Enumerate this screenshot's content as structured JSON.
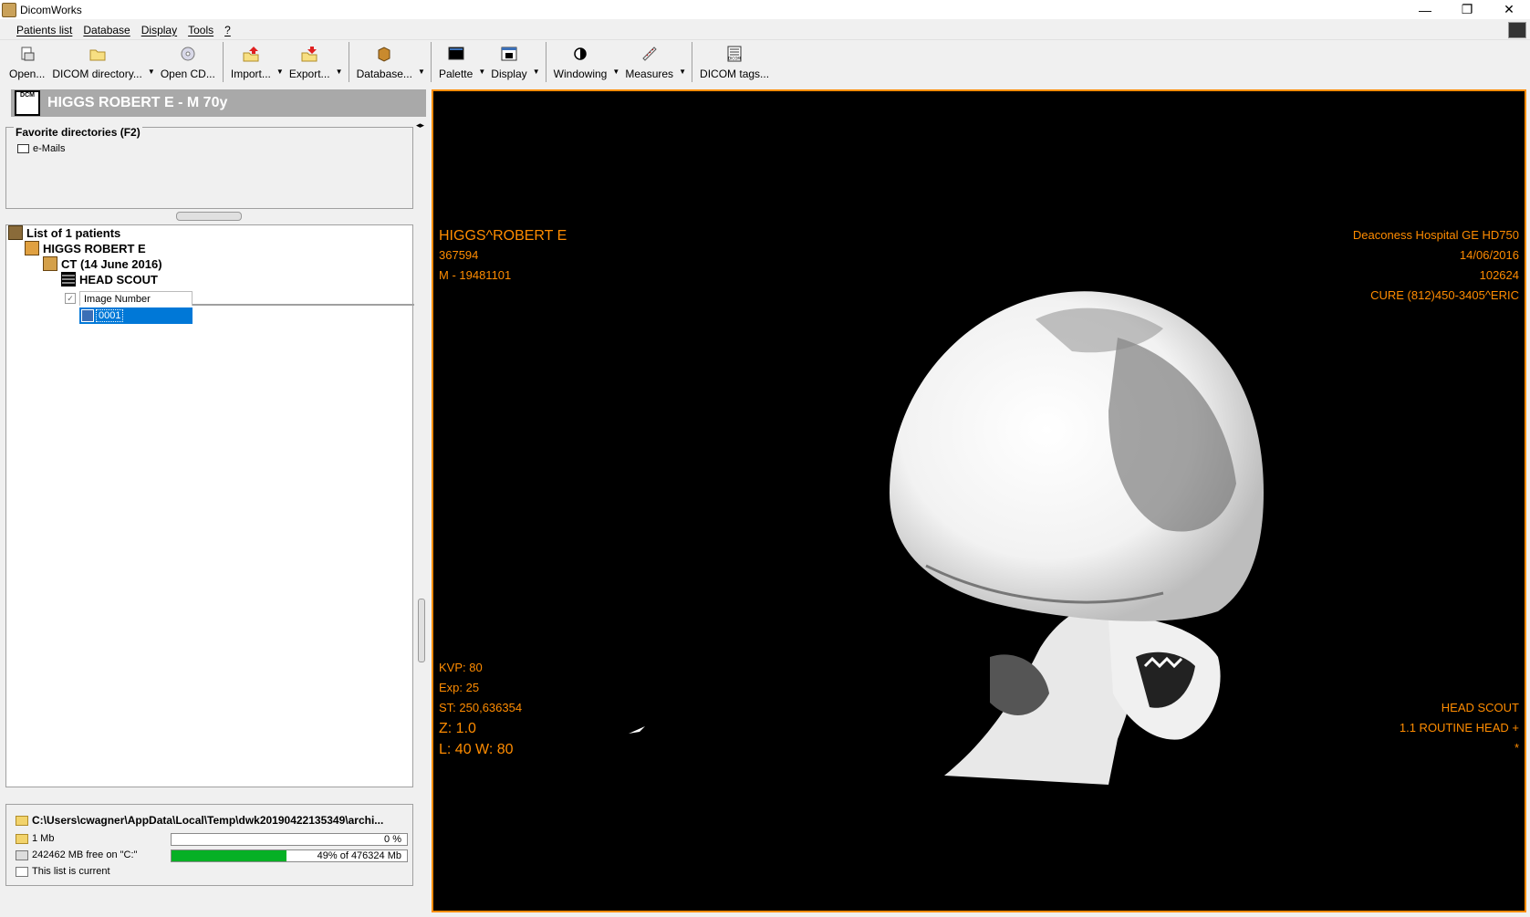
{
  "window": {
    "title": "DicomWorks",
    "controls": {
      "minimize": "—",
      "restore": "❐",
      "close": "✕"
    }
  },
  "menu": {
    "items": [
      {
        "label": "Patients list"
      },
      {
        "label": "Database"
      },
      {
        "label": "Display"
      },
      {
        "label": "Tools"
      },
      {
        "label": "?"
      }
    ]
  },
  "toolbar": {
    "open": "Open...",
    "dicom_directory": "DICOM directory...",
    "open_cd": "Open CD...",
    "import": "Import...",
    "export": "Export...",
    "database": "Database...",
    "palette": "Palette",
    "display": "Display",
    "windowing": "Windowing",
    "measures": "Measures",
    "dicom_tags": "DICOM tags...",
    "dicom_tags_icon_caption": "DICOM"
  },
  "patient_header": {
    "icon_caption": "DCM",
    "title": "HIGGS ROBERT E - M 70y"
  },
  "favorites": {
    "legend": "Favorite directories (F2)",
    "items": [
      {
        "label": "e-Mails"
      }
    ]
  },
  "tree": {
    "root": "List of 1 patients",
    "patient": "HIGGS ROBERT E",
    "study": "CT (14 June 2016)",
    "series": "HEAD SCOUT",
    "column_header": "Image Number",
    "rows": [
      {
        "value": "0001"
      }
    ]
  },
  "status": {
    "path": "C:\\Users\\cwagner\\AppData\\Local\\Temp\\dwk20190422135349\\archi...",
    "size": "1 Mb",
    "size_progress_text": "0 %",
    "size_progress": 0,
    "disk": "242462 MB free on \"C:\"",
    "disk_progress_text": "49% of 476324 Mb",
    "disk_progress": 0.49,
    "list_state": "This list is current"
  },
  "overlay": {
    "top_left": [
      "HIGGS^ROBERT E",
      "367594",
      "M - 19481101"
    ],
    "top_right": [
      "Deaconess Hospital GE HD750",
      "14/06/2016",
      "102624",
      "CURE (812)450-3405^ERIC"
    ],
    "bottom_left": [
      "KVP: 80",
      "Exp: 25",
      "ST: 250,636354",
      "Z: 1.0",
      "L: 40 W: 80"
    ],
    "bottom_right": [
      "HEAD SCOUT",
      "1.1 ROUTINE HEAD +",
      "*"
    ]
  },
  "colors": {
    "overlay_text": "#ff8c00",
    "viewer_border": "#ff8c00",
    "selection": "#0078d7",
    "progress": "#06b025"
  }
}
